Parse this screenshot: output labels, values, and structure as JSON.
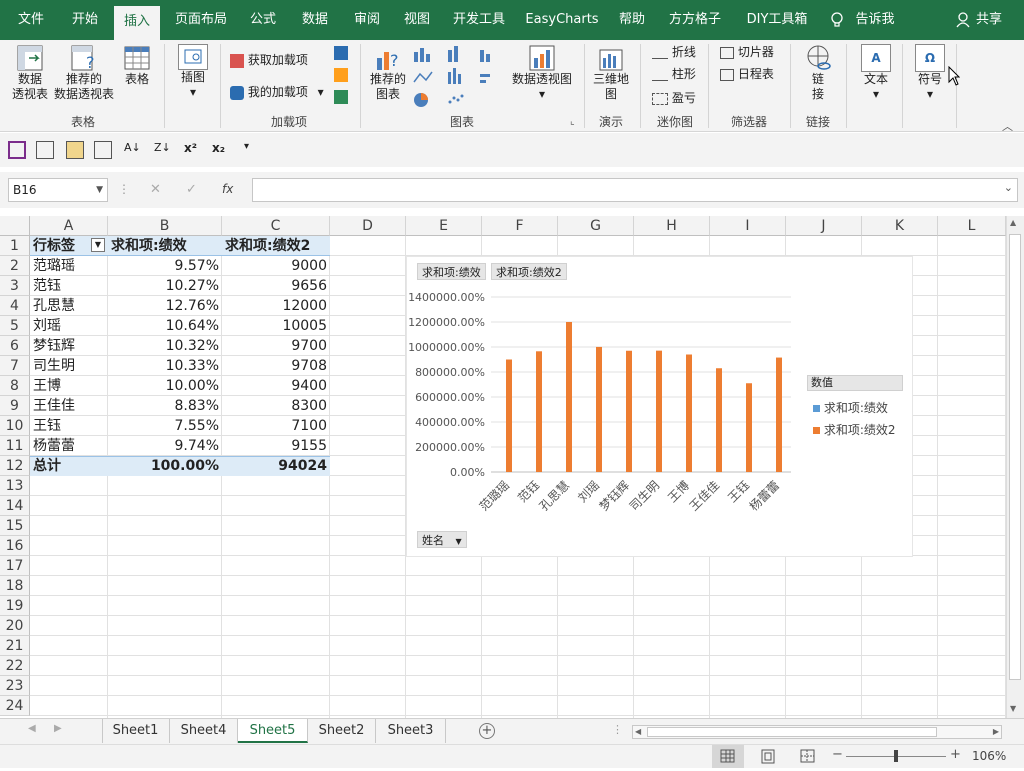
{
  "ribbon_tabs": [
    "文件",
    "开始",
    "插入",
    "页面布局",
    "公式",
    "数据",
    "审阅",
    "视图",
    "开发工具",
    "EasyCharts",
    "帮助",
    "方方格子",
    "DIY工具箱",
    "告诉我",
    "共享"
  ],
  "ribbon": {
    "pivot_table": "数据\n透视表",
    "pivot_table_l1": "数据",
    "pivot_table_l2": "透视表",
    "recommended_pivot_l1": "推荐的",
    "recommended_pivot_l2": "数据透视表",
    "table": "表格",
    "group_tables": "表格",
    "illustrations": "插图",
    "get_addins": "获取加载项",
    "my_addins": "我的加载项",
    "group_addins": "加载项",
    "recommended_charts_l1": "推荐的",
    "recommended_charts_l2": "图表",
    "pivot_chart": "数据透视图",
    "group_charts": "图表",
    "map3d_l1": "三维地",
    "map3d_l2": "图",
    "group_tours": "演示",
    "spark_line": "折线",
    "spark_column": "柱形",
    "spark_winloss": "盈亏",
    "group_sparklines": "迷你图",
    "slicer": "切片器",
    "timeline": "日程表",
    "group_filters": "筛选器",
    "link_l1": "链",
    "link_l2": "接",
    "group_links": "链接",
    "text": "文本",
    "symbol": "符号"
  },
  "formula_bar": {
    "name_box": "B16",
    "formula": ""
  },
  "columns": [
    "A",
    "B",
    "C",
    "D",
    "E",
    "F",
    "G",
    "H",
    "I",
    "J",
    "K",
    "L"
  ],
  "rows": [
    "1",
    "2",
    "3",
    "4",
    "5",
    "6",
    "7",
    "8",
    "9",
    "10",
    "11",
    "12",
    "13",
    "14",
    "15",
    "16",
    "17",
    "18",
    "19",
    "20",
    "21",
    "22",
    "23",
    "24"
  ],
  "pivot": {
    "headers": [
      "行标签",
      "求和项:绩效",
      "求和项:绩效2"
    ],
    "rows": [
      [
        "范璐瑶",
        "9.57%",
        "9000"
      ],
      [
        "范钰",
        "10.27%",
        "9656"
      ],
      [
        "孔思慧",
        "12.76%",
        "12000"
      ],
      [
        "刘瑶",
        "10.64%",
        "10005"
      ],
      [
        "梦钰辉",
        "10.32%",
        "9700"
      ],
      [
        "司生明",
        "10.33%",
        "9708"
      ],
      [
        "王博",
        "10.00%",
        "9400"
      ],
      [
        "王佳佳",
        "8.83%",
        "8300"
      ],
      [
        "王钰",
        "7.55%",
        "7100"
      ],
      [
        "杨蕾蕾",
        "9.74%",
        "9155"
      ]
    ],
    "total": [
      "总计",
      "100.00%",
      "94024"
    ]
  },
  "chart_data": {
    "type": "bar",
    "field_buttons": [
      "求和项:绩效",
      "求和项:绩效2"
    ],
    "axis_field_button": "姓名",
    "categories": [
      "范璐瑶",
      "范钰",
      "孔思慧",
      "刘瑶",
      "梦钰辉",
      "司生明",
      "王博",
      "王佳佳",
      "王钰",
      "杨蕾蕾"
    ],
    "series": [
      {
        "name": "求和项:绩效",
        "values": [
          0.0957,
          0.1027,
          0.1276,
          0.1064,
          0.1032,
          0.1033,
          0.1,
          0.0883,
          0.0755,
          0.0974
        ],
        "color": "#5b9bd5"
      },
      {
        "name": "求和项:绩效2",
        "values": [
          9000,
          9656,
          12000,
          10005,
          9700,
          9708,
          9400,
          8300,
          7100,
          9155
        ],
        "color": "#ed7d31"
      }
    ],
    "y_ticks": [
      "1400000.00%",
      "1200000.00%",
      "1000000.00%",
      "800000.00%",
      "600000.00%",
      "400000.00%",
      "200000.00%",
      "0.00%"
    ],
    "ylim": [
      0,
      14000
    ],
    "legend_title": "数值",
    "legend_position": "right",
    "grid": true
  },
  "sheets": [
    "Sheet1",
    "Sheet4",
    "Sheet5",
    "Sheet2",
    "Sheet3"
  ],
  "active_sheet": "Sheet5",
  "status": {
    "zoom": "106%"
  },
  "colors": {
    "accent": "#217346",
    "pivot_header_bg": "#ddebf7"
  }
}
